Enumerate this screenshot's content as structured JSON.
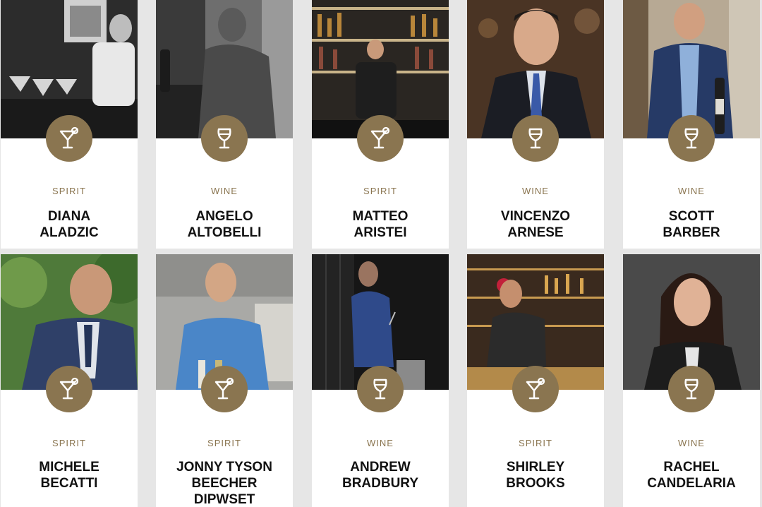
{
  "colors": {
    "badge": "#8a7550",
    "category_text": "#8a7550",
    "name_text": "#111111",
    "page_bg": "#e6e6e6"
  },
  "cards": [
    {
      "category": "SPIRIT",
      "icon": "cocktail-glass-icon",
      "name_lines": [
        "DIANA",
        "ALADZIC"
      ]
    },
    {
      "category": "WINE",
      "icon": "wine-glass-icon",
      "name_lines": [
        "ANGELO",
        "ALTOBELLI"
      ]
    },
    {
      "category": "SPIRIT",
      "icon": "cocktail-glass-icon",
      "name_lines": [
        "MATTEO",
        "ARISTEI"
      ]
    },
    {
      "category": "WINE",
      "icon": "wine-glass-icon",
      "name_lines": [
        "VINCENZO",
        "ARNESE"
      ]
    },
    {
      "category": "WINE",
      "icon": "wine-glass-icon",
      "name_lines": [
        "SCOTT",
        "BARBER"
      ]
    },
    {
      "category": "SPIRIT",
      "icon": "cocktail-glass-icon",
      "name_lines": [
        "MICHELE",
        "BECATTI"
      ]
    },
    {
      "category": "SPIRIT",
      "icon": "cocktail-glass-icon",
      "name_lines": [
        "JONNY TYSON",
        "BEECHER",
        "DIPWSET"
      ]
    },
    {
      "category": "WINE",
      "icon": "wine-glass-icon",
      "name_lines": [
        "ANDREW",
        "BRADBURY"
      ]
    },
    {
      "category": "SPIRIT",
      "icon": "cocktail-glass-icon",
      "name_lines": [
        "SHIRLEY",
        "BROOKS"
      ]
    },
    {
      "category": "WINE",
      "icon": "wine-glass-icon",
      "name_lines": [
        "RACHEL",
        "CANDELARIA"
      ]
    }
  ]
}
